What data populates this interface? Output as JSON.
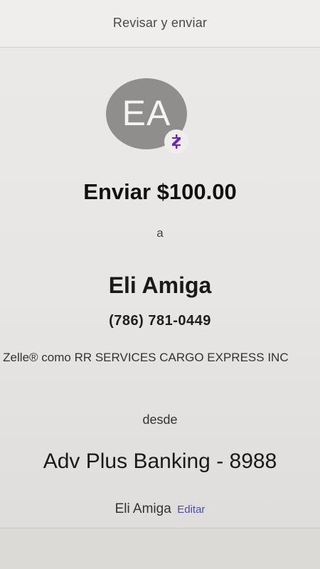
{
  "header": {
    "title": "Revisar y enviar"
  },
  "recipient": {
    "initials": "EA",
    "name": "Eli Amiga",
    "phone": "(786) 781-0449",
    "enrolled_text": "n Zelle® como RR SERVICES CARGO EXPRESS INC"
  },
  "badge": {
    "icon": "zelle-icon",
    "color": "#6a1fd0"
  },
  "transfer": {
    "amount_label": "Enviar $100.00",
    "connector": "a",
    "from_label": "desde"
  },
  "account": {
    "name": "Adv Plus Banking - 8988"
  },
  "sender": {
    "name": "Eli Amiga",
    "edit_label": "Editar"
  },
  "colors": {
    "link": "#4a4fb0",
    "avatar": "#8f8e8d"
  }
}
